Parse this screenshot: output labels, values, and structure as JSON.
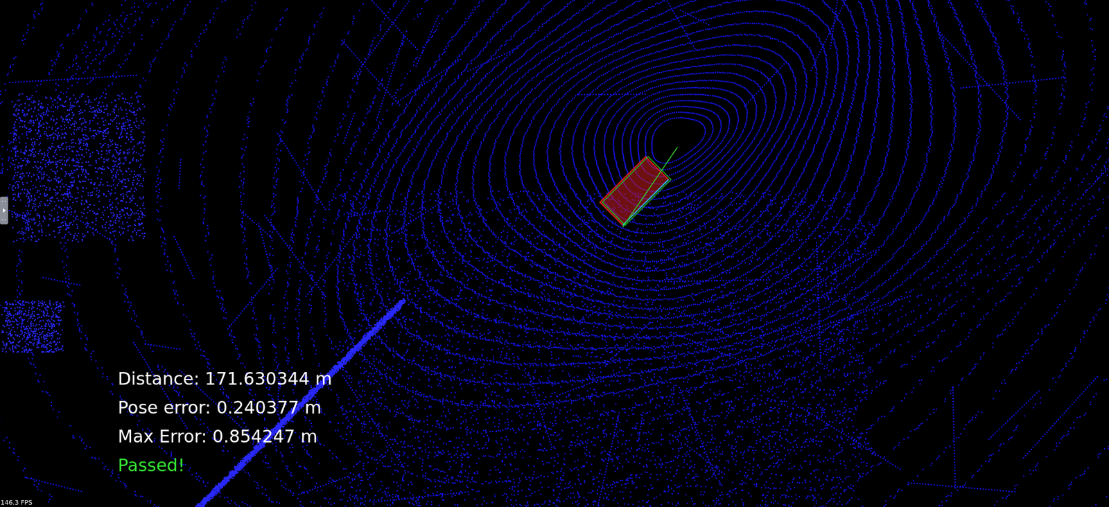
{
  "overlay": {
    "lines": [
      {
        "text": "Distance: 171.630344 m",
        "color": "#ffffff"
      },
      {
        "text": "Pose error: 0.240377 m",
        "color": "#ffffff"
      },
      {
        "text": "Max Error: 0.854247 m",
        "color": "#ffffff"
      },
      {
        "text": "Passed!",
        "color": "#33e433"
      }
    ]
  },
  "fps": "146.3 FPS"
}
